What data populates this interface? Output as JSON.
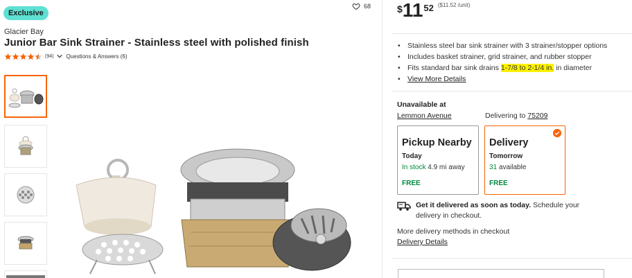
{
  "product": {
    "badge": "Exclusive",
    "favorites_count": "68",
    "brand": "Glacier Bay",
    "title": "Junior Bar Sink Strainer - Stainless steel with polished finish",
    "rating": 4.5,
    "review_count": "(94)",
    "qa_label": "Questions & Answers (6)"
  },
  "price": {
    "currency": "$",
    "dollars": "11",
    "cents": "52",
    "unit_price": "($11.52 /unit)"
  },
  "highlights": {
    "items": [
      "Stainless steel bar sink strainer with 3 strainer/stopper options",
      "Includes basket strainer, grid strainer, and rubber stopper"
    ],
    "fits_prefix": "Fits standard bar sink drains ",
    "fits_highlight": "1-7/8 to 2-1/4 in.",
    "fits_suffix": " in diameter",
    "view_more": "View More Details"
  },
  "fulfillment": {
    "unavailable_label": "Unavailable at",
    "store_name": "Lemmon Avenue",
    "delivering_prefix": "Delivering to ",
    "zip": "75209",
    "pickup": {
      "heading": "Pickup Nearby",
      "day": "Today",
      "stock_status": "In stock",
      "distance": " 4.9 mi away",
      "cost": "FREE"
    },
    "delivery": {
      "heading": "Delivery",
      "day": "Tomorrow",
      "count": "31",
      "count_suffix": " available",
      "cost": "FREE"
    },
    "asap_bold": "Get it delivered as soon as today.",
    "asap_rest": " Schedule your delivery in checkout.",
    "more_methods": "More delivery methods in checkout",
    "delivery_details": "Delivery Details"
  },
  "colors": {
    "accent": "#f96302",
    "badge": "#5ee0d2",
    "stock_green": "#00873c",
    "highlight": "#fff200"
  }
}
